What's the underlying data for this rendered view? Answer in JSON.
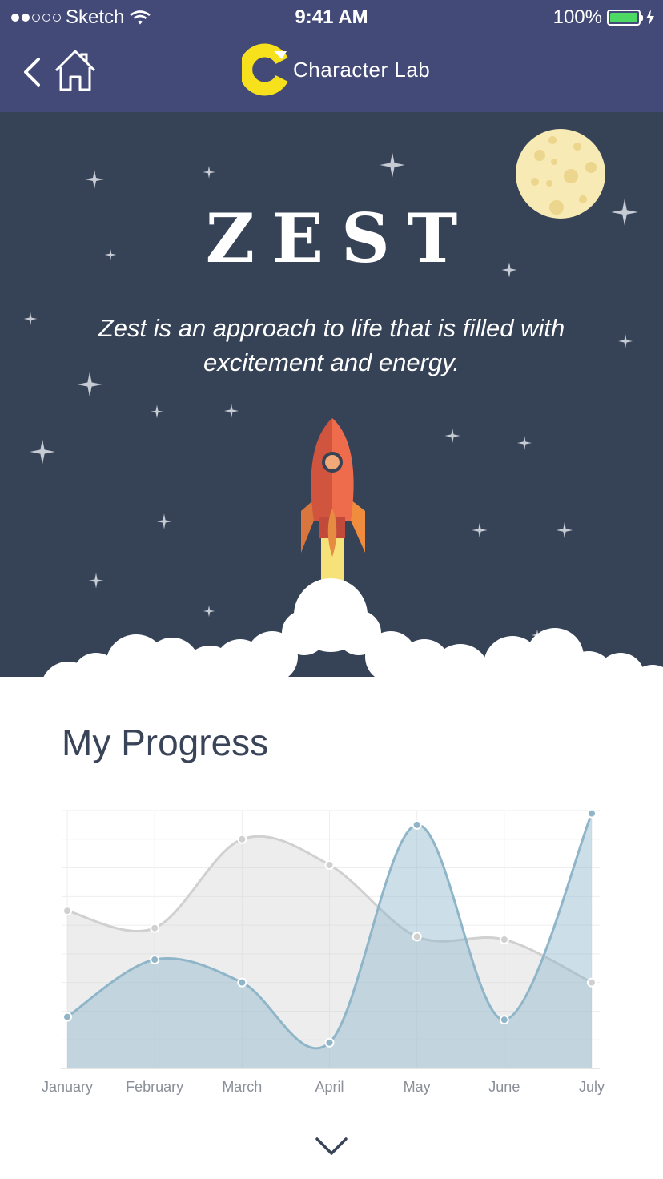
{
  "status_bar": {
    "carrier": "Sketch",
    "time": "9:41 AM",
    "battery": "100%",
    "signal_bars": 2
  },
  "nav": {
    "back_icon": "chevron-left-icon",
    "home_icon": "home-icon",
    "logo_text": "Character Lab",
    "logo_color": "#f7e01c"
  },
  "hero": {
    "title": "ZEST",
    "description": "Zest is an approach to life that is filled with excitement and energy.",
    "background": "#364357",
    "illustration": "rocket-launch"
  },
  "progress": {
    "title": "My Progress"
  },
  "chart_data": {
    "type": "area",
    "categories": [
      "January",
      "February",
      "March",
      "April",
      "May",
      "June",
      "July"
    ],
    "series": [
      {
        "values": [
          55,
          49,
          80,
          71,
          46,
          45,
          30
        ],
        "color": "#d0d0d0"
      },
      {
        "values": [
          18,
          38,
          30,
          9,
          85,
          17,
          89
        ],
        "color": "#8fb5c9"
      }
    ],
    "ylim": [
      0,
      90
    ],
    "grid": true
  }
}
